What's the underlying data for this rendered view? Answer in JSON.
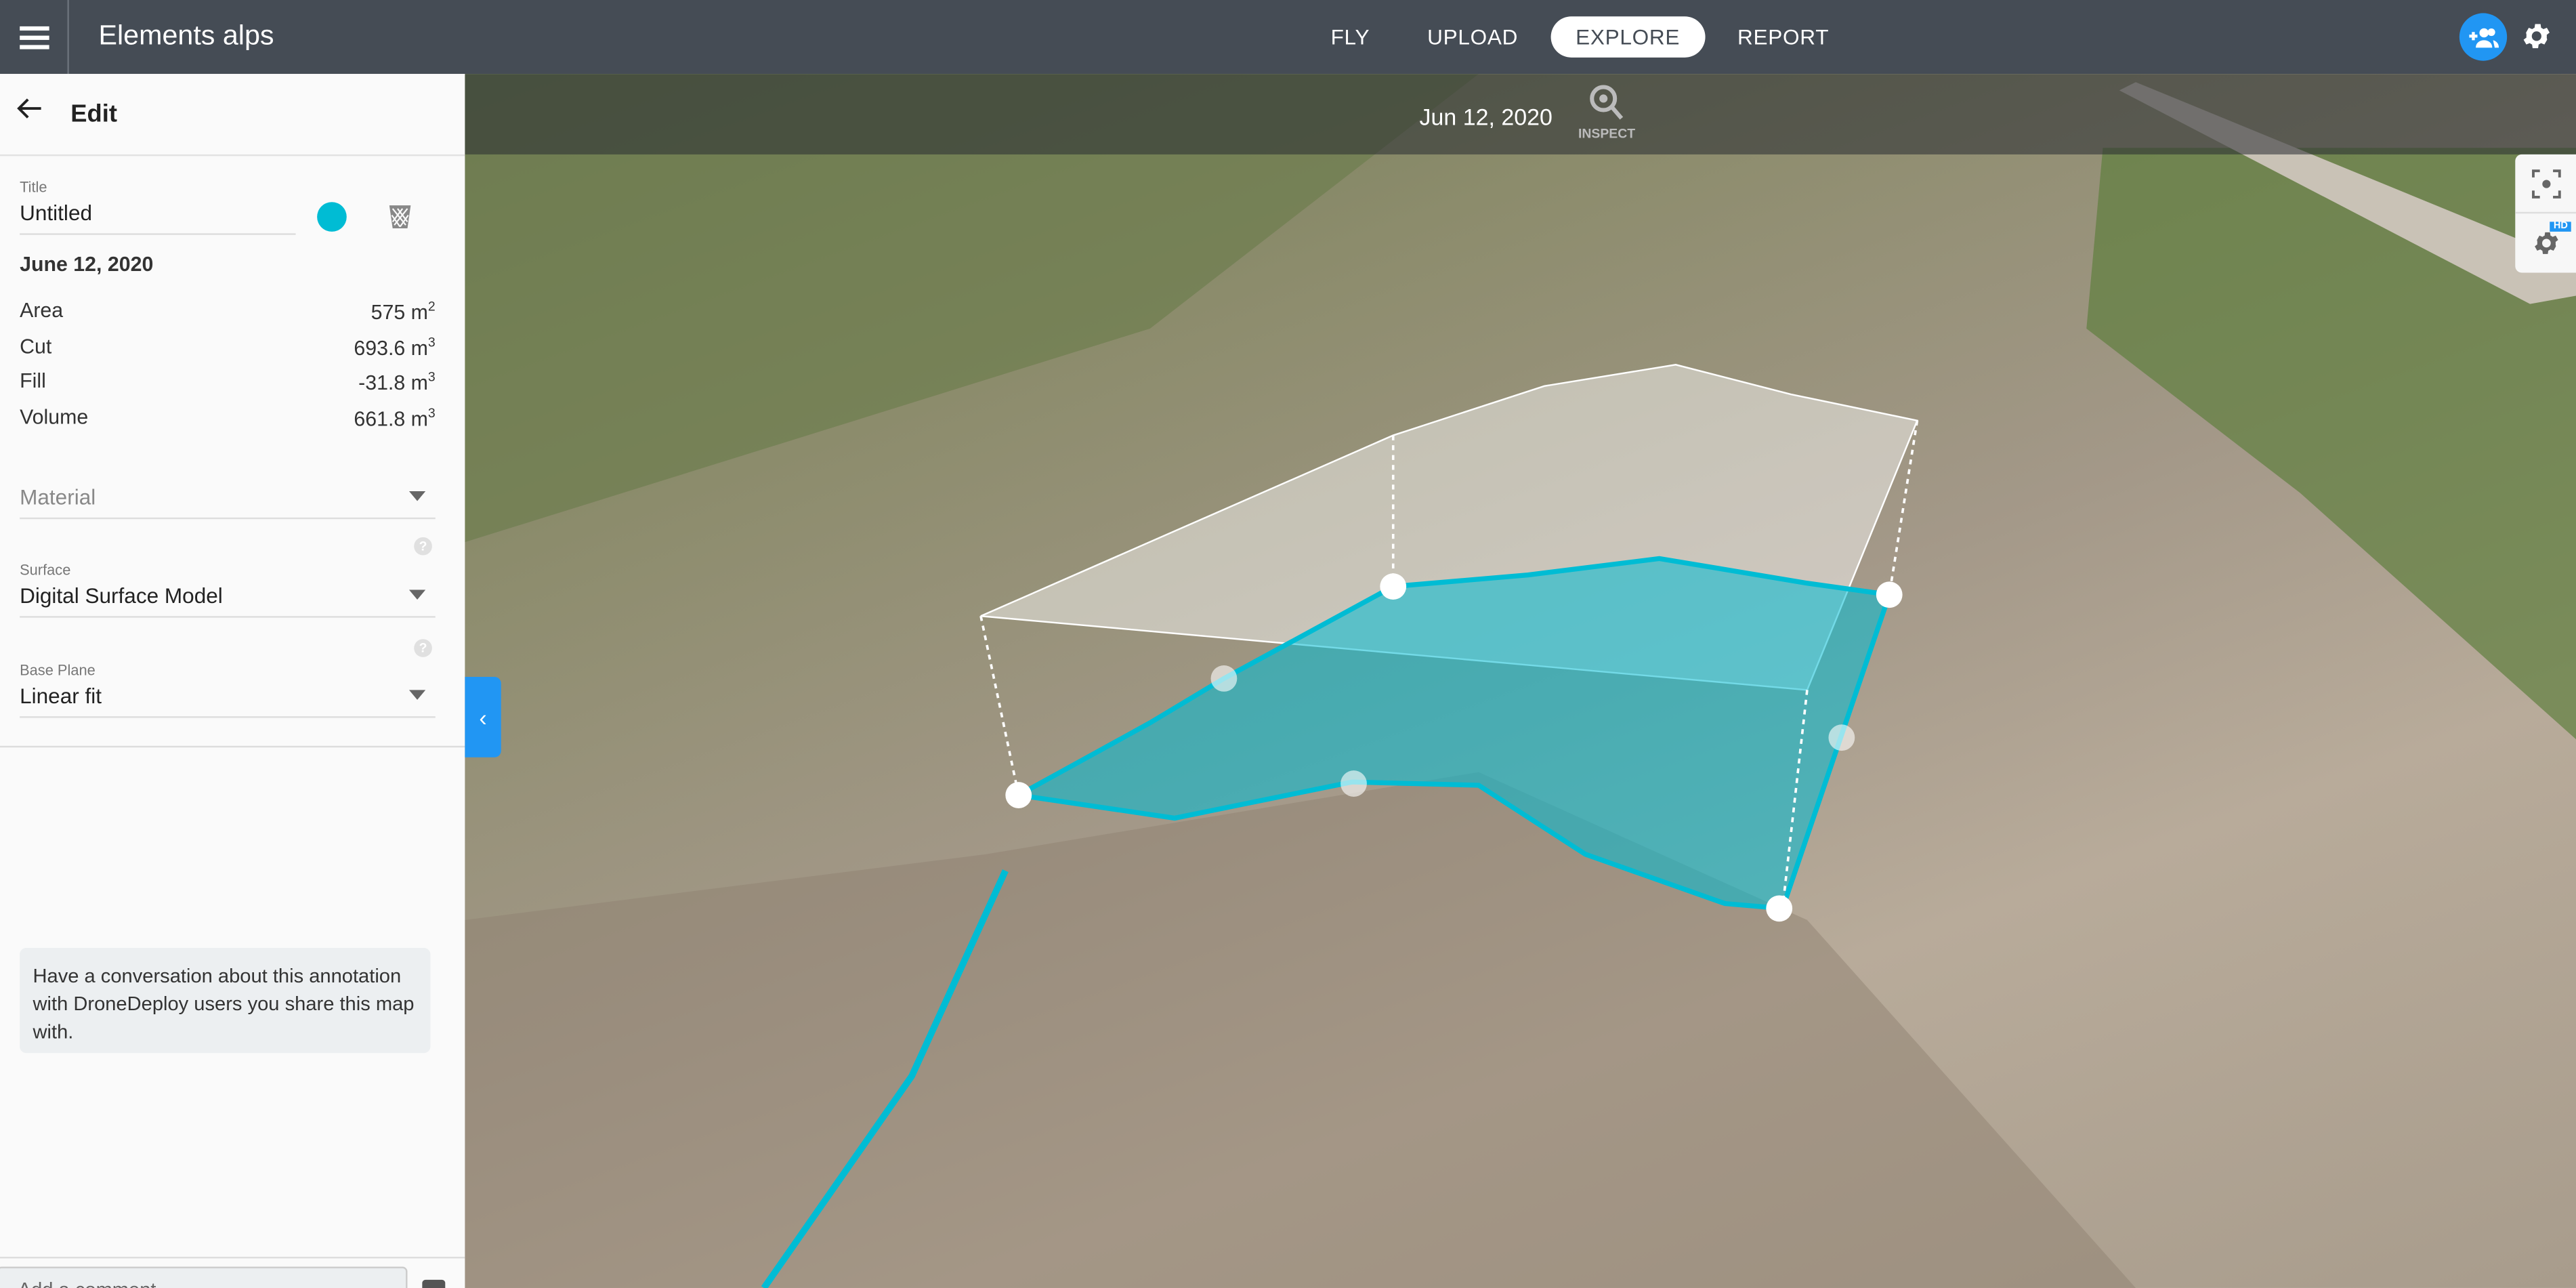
{
  "header": {
    "app_title": "Elements alps",
    "nav": [
      {
        "label": "FLY"
      },
      {
        "label": "UPLOAD"
      },
      {
        "label": "EXPLORE",
        "active": true
      },
      {
        "label": "REPORT"
      }
    ]
  },
  "panel": {
    "heading": "Edit",
    "title_label": "Title",
    "title_value": "Untitled",
    "annotation_color": "#00bcd4",
    "date": "June 12, 2020",
    "stats": [
      {
        "label": "Area",
        "value": "575 m",
        "unit_exp": "2"
      },
      {
        "label": "Cut",
        "value": "693.6 m",
        "unit_exp": "3"
      },
      {
        "label": "Fill",
        "value": "-31.8 m",
        "unit_exp": "3"
      },
      {
        "label": "Volume",
        "value": "661.8 m",
        "unit_exp": "3"
      }
    ],
    "material_placeholder": "Material",
    "surface_label": "Surface",
    "surface_value": "Digital Surface Model",
    "base_plane_label": "Base Plane",
    "base_plane_value": "Linear fit",
    "help_glyph": "?",
    "note": "Have a conversation about this annotation with DroneDeploy users you share this map with.",
    "comment_placeholder": "Add a comment"
  },
  "map": {
    "date": "Jun 12, 2020",
    "inspect_label": "INSPECT",
    "hd_badge": "HD",
    "accent": "#2196f3"
  }
}
